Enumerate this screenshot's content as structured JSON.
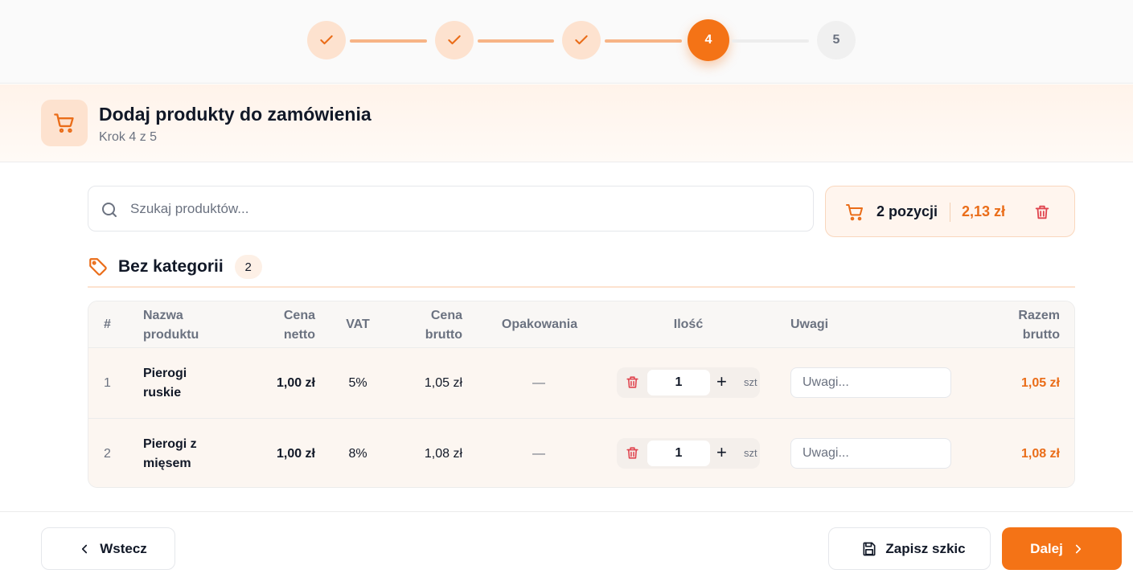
{
  "stepper": {
    "steps": [
      {
        "label": "",
        "state": "done"
      },
      {
        "label": "",
        "state": "done"
      },
      {
        "label": "",
        "state": "done"
      },
      {
        "label": "4",
        "state": "active"
      },
      {
        "label": "5",
        "state": "todo"
      }
    ]
  },
  "header": {
    "icon": "shopping-cart-icon",
    "title": "Dodaj produkty do zamówienia",
    "subtitle": "Krok 4 z 5"
  },
  "search": {
    "placeholder": "Szukaj produktów...",
    "value": ""
  },
  "cart": {
    "count_label": "2 pozycji",
    "total": "2,13 zł"
  },
  "category": {
    "name": "Bez kategorii",
    "count": "2"
  },
  "table": {
    "headers": {
      "num": "#",
      "name_1": "Nazwa",
      "name_2": "produktu",
      "net_1": "Cena",
      "net_2": "netto",
      "vat": "VAT",
      "gross_1": "Cena",
      "gross_2": "brutto",
      "packaging": "Opakowania",
      "qty": "Ilość",
      "notes": "Uwagi",
      "total_1": "Razem",
      "total_2": "brutto"
    },
    "rows": [
      {
        "num": "1",
        "name_1": "Pierogi",
        "name_2": "ruskie",
        "net": "1,00 zł",
        "vat": "5%",
        "gross": "1,05 zł",
        "packaging": "—",
        "qty": "1",
        "unit": "szt",
        "note_placeholder": "Uwagi...",
        "total": "1,05 zł"
      },
      {
        "num": "2",
        "name_1": "Pierogi z",
        "name_2": "mięsem",
        "net": "1,00 zł",
        "vat": "8%",
        "gross": "1,08 zł",
        "packaging": "—",
        "qty": "1",
        "unit": "szt",
        "note_placeholder": "Uwagi...",
        "total": "1,08 zł"
      }
    ]
  },
  "footer": {
    "back_label": "Wstecz",
    "save_label": "Zapisz szkic",
    "next_label": "Dalej"
  },
  "colors": {
    "accent": "#f47316",
    "accent_text": "#ea6d19",
    "accent_soft": "#fde2cf",
    "danger": "#e0454f"
  }
}
